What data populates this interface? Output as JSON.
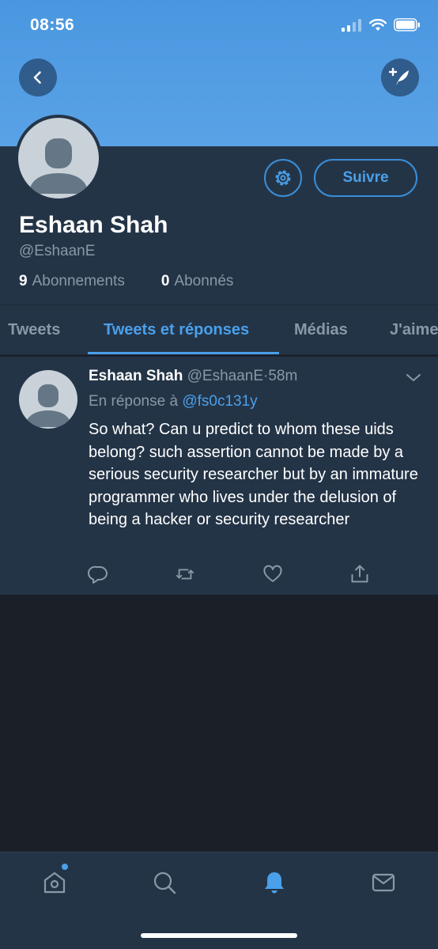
{
  "status_bar": {
    "time": "08:56"
  },
  "profile": {
    "name": "Eshaan Shah",
    "handle": "@EshaanE",
    "follow_label": "Suivre",
    "following_count": "9",
    "following_label": "Abonnements",
    "followers_count": "0",
    "followers_label": "Abonnés"
  },
  "tabs": [
    {
      "label": "Tweets"
    },
    {
      "label": "Tweets et réponses"
    },
    {
      "label": "Médias"
    },
    {
      "label": "J'aime"
    }
  ],
  "active_tab": "Tweets et réponses",
  "tweet": {
    "author_name": "Eshaan Shah",
    "author_handle": "@EshaanE",
    "separator": "·",
    "time": "58m",
    "reply_prefix": "En réponse à",
    "reply_to": "@fs0c131y",
    "text": "So what? Can u predict to whom these uids belong? such assertion cannot be made by a serious security researcher but by an immature programmer who lives under the delusion of being a hacker or security researcher"
  },
  "icons": {
    "back": "chevron-left-icon",
    "compose": "compose-tweet-icon",
    "settings": "gear-icon",
    "reply": "reply-icon",
    "retweet": "retweet-icon",
    "like": "heart-icon",
    "share": "share-icon",
    "nav_home": "home-icon",
    "nav_search": "search-icon",
    "nav_notifications": "bell-icon",
    "nav_messages": "mail-icon"
  },
  "colors": {
    "accent": "#4aa0ea",
    "banner": "#4a97e0",
    "surface": "#243447",
    "background": "#1a1f28",
    "muted_text": "#8899a6"
  }
}
